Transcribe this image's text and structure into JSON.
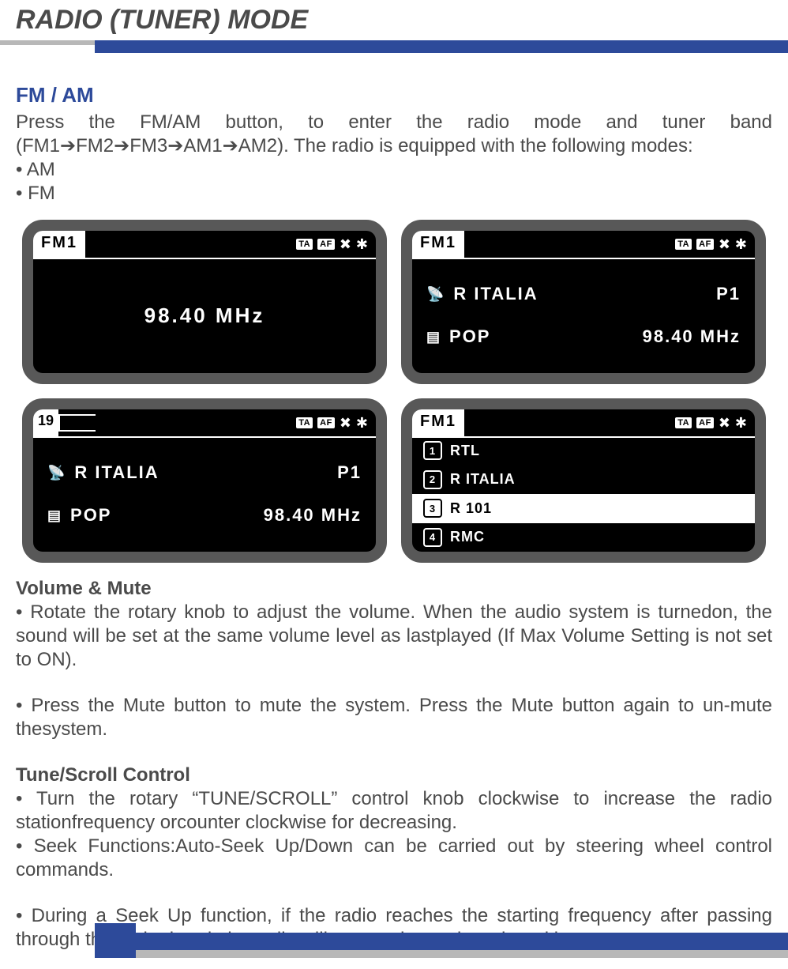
{
  "header": {
    "title": "RADIO (TUNER) MODE"
  },
  "section_fm_am": {
    "heading": "FM / AM",
    "para": "Press the FM/AM button, to enter the radio mode and tuner band (FM1➔FM2➔FM3➔AM1➔AM2). The radio is equipped with the following modes:",
    "bullet1": "• AM",
    "bullet2": "• FM"
  },
  "screens": {
    "s1": {
      "band": "FM1",
      "badges": {
        "ta": "TA",
        "af": "AF"
      },
      "freq": "98.40 MHz"
    },
    "s2": {
      "band": "FM1",
      "badges": {
        "ta": "TA",
        "af": "AF"
      },
      "row1_left": "R ITALIA",
      "row1_right": "P1",
      "row2_left": "POP",
      "row2_right": "98.40 MHz"
    },
    "s3": {
      "progress_label": "19",
      "badges": {
        "ta": "TA",
        "af": "AF"
      },
      "row1_left": "R ITALIA",
      "row1_right": "P1",
      "row2_left": "POP",
      "row2_right": "98.40 MHz"
    },
    "s4": {
      "band": "FM1",
      "badges": {
        "ta": "TA",
        "af": "AF"
      },
      "items": [
        {
          "num": "1",
          "label": "RTL"
        },
        {
          "num": "2",
          "label": "R ITALIA"
        },
        {
          "num": "3",
          "label": "R 101"
        },
        {
          "num": "4",
          "label": "RMC"
        }
      ],
      "selected_index": 2
    }
  },
  "section_volume": {
    "heading": "Volume & Mute",
    "p1": "• Rotate the rotary knob to adjust the volume. When the audio system is turnedon, the sound will be set at the same volume level as lastplayed (If Max Volume Setting is not set to ON).",
    "p2": "• Press the Mute button to mute the system. Press the Mute button again to un-mute thesystem."
  },
  "section_tune": {
    "heading": "Tune/Scroll Control",
    "p1": "• Turn the rotary “TUNE/SCROLL” control knob clockwise to increase the radio stationfrequency orcounter clockwise for decreasing.",
    "p2": "• Seek Functions:Auto-Seek Up/Down can be carried out by steering wheel control commands.",
    "p3": "• During a Seek Up function, if the radio reaches the starting frequency after passing through the entire band, the radio will stop at the station where itbegan."
  }
}
